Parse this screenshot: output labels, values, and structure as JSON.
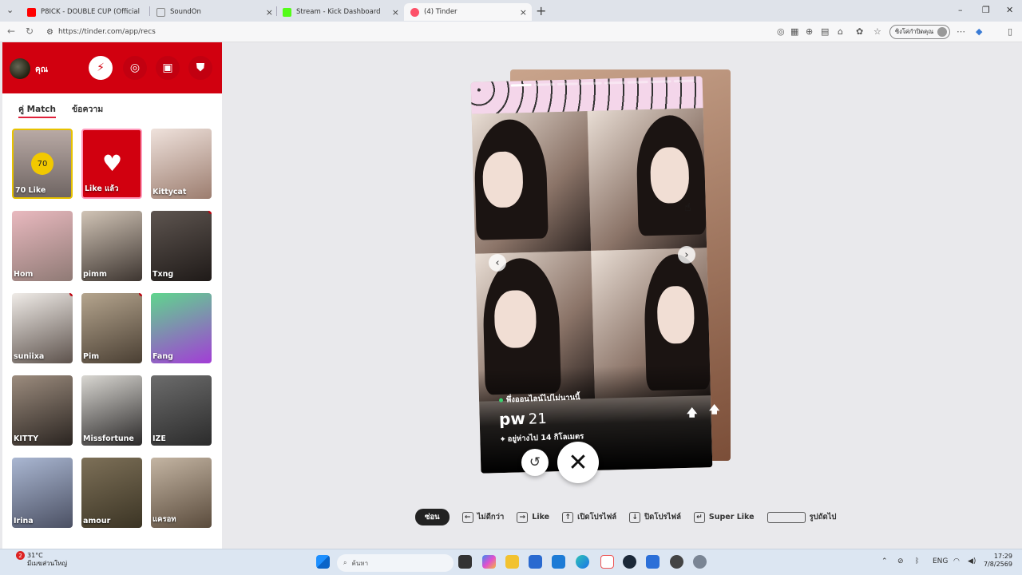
{
  "browser": {
    "tabs": [
      {
        "title": "P8ICK - DOUBLE CUP (Official",
        "icon": "youtube-icon",
        "color": "#ff0000"
      },
      {
        "title": "SoundOn",
        "icon": "soundon-icon",
        "color": "#888888"
      },
      {
        "title": "Stream - Kick Dashboard",
        "icon": "kick-icon",
        "color": "#53fc18"
      },
      {
        "title": "(4) Tinder",
        "icon": "tinder-icon",
        "color": "#fd5068"
      }
    ],
    "url": "https://tinder.com/app/recs",
    "profile_label": "ซิงโค่กำปิดคุณ"
  },
  "sidebar": {
    "username": "คุณ",
    "tabs": [
      {
        "label": "คู่ Match"
      },
      {
        "label": "ข้อความ"
      }
    ],
    "likes_count": "70",
    "likes_label": "70 Like",
    "liked_label": "Like แล้ว",
    "matches": [
      {
        "name": "Kittycat",
        "colors": [
          "#efe2dc",
          "#9c7d6f"
        ]
      },
      {
        "name": "Hom",
        "colors": [
          "#e9b9bf",
          "#8f7a75"
        ]
      },
      {
        "name": "pimm",
        "colors": [
          "#d1c4b6",
          "#3d3530"
        ]
      },
      {
        "name": "Txng",
        "colors": [
          "#5e5550",
          "#1f1a18"
        ],
        "dot": true
      },
      {
        "name": "suniixa",
        "colors": [
          "#f0ece8",
          "#5d524c"
        ],
        "dot": true
      },
      {
        "name": "Pim",
        "colors": [
          "#b5a58e",
          "#4a3f33"
        ],
        "dot": true
      },
      {
        "name": "Fang",
        "colors": [
          "#5fd68d",
          "#a23dd6"
        ]
      },
      {
        "name": "KITTY",
        "colors": [
          "#9c8c7e",
          "#2a2420"
        ]
      },
      {
        "name": "Missfortune",
        "colors": [
          "#d9d7d2",
          "#2a2828"
        ]
      },
      {
        "name": "IZE",
        "colors": [
          "#6c6c6c",
          "#2b2b2b"
        ]
      },
      {
        "name": "Irina",
        "colors": [
          "#aab7d2",
          "#4b5063"
        ]
      },
      {
        "name": "amour",
        "colors": [
          "#7d7058",
          "#3b3424"
        ]
      },
      {
        "name": "แครอท",
        "colors": [
          "#c4b5a3",
          "#5a4b3c"
        ]
      }
    ]
  },
  "profile": {
    "online_status": "พึ่งออนไลน์ไปไม่นานนี้",
    "name": "pw",
    "age": "21",
    "distance": "อยู่ห่างไป 14 กิโลเมตร",
    "photo_count": 8,
    "photo_index": 1
  },
  "hints": {
    "hide": "ซ่อน",
    "nope": "ไม่ดีกว่า",
    "like": "Like",
    "open_profile": "เปิดโปรไฟล์",
    "close_profile": "ปิดโปรไฟล์",
    "super_like": "Super Like",
    "next_photo": "รูปถัดไป"
  },
  "taskbar": {
    "weather_temp": "31°C",
    "weather_desc": "มีเมฆส่วนใหญ่",
    "weather_badge": "2",
    "search_placeholder": "ค้นหา",
    "lang": "ENG",
    "time": "17:29",
    "date": "7/8/2569"
  }
}
